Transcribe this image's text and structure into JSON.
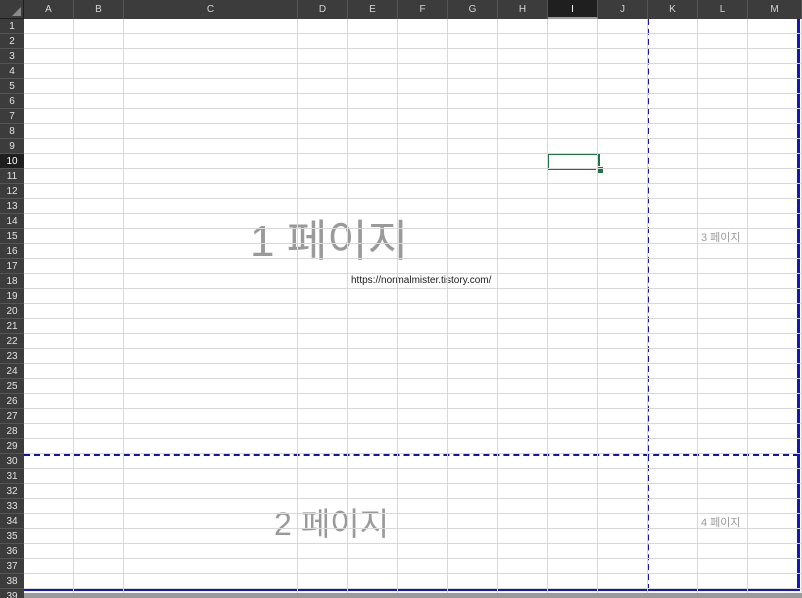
{
  "columns": [
    {
      "id": "col-header-a",
      "label": "A"
    },
    {
      "id": "col-header-b",
      "label": "B"
    },
    {
      "id": "col-header-c",
      "label": "C"
    },
    {
      "id": "col-header-d",
      "label": "D"
    },
    {
      "id": "col-header-e",
      "label": "E"
    },
    {
      "id": "col-header-f",
      "label": "F"
    },
    {
      "id": "col-header-g",
      "label": "G"
    },
    {
      "id": "col-header-h",
      "label": "H"
    },
    {
      "id": "col-header-i",
      "label": "I"
    },
    {
      "id": "col-header-j",
      "label": "J"
    },
    {
      "id": "col-header-k",
      "label": "K"
    },
    {
      "id": "col-header-l",
      "label": "L"
    },
    {
      "id": "col-header-m",
      "label": "M"
    }
  ],
  "rows": [
    "1",
    "2",
    "3",
    "4",
    "5",
    "6",
    "7",
    "8",
    "9",
    "10",
    "11",
    "12",
    "13",
    "14",
    "15",
    "16",
    "17",
    "18",
    "19",
    "20",
    "21",
    "22",
    "23",
    "24",
    "25",
    "26",
    "27",
    "28",
    "29",
    "30",
    "31",
    "32",
    "33",
    "34",
    "35",
    "36",
    "37",
    "38",
    "39"
  ],
  "selection": {
    "column": "I",
    "row": "10"
  },
  "cell_text": {
    "E18": "https://normalmister.tistory.com/"
  },
  "page_watermarks": {
    "page1": "1 페이지",
    "page2": "2 페이지",
    "page3": "3 페이지",
    "page4": "4 페이지"
  },
  "colors": {
    "header_bg": "#3c3c3c",
    "selection_border": "#217346",
    "page_break": "#1414a8",
    "watermark": "#9a9a9a"
  }
}
